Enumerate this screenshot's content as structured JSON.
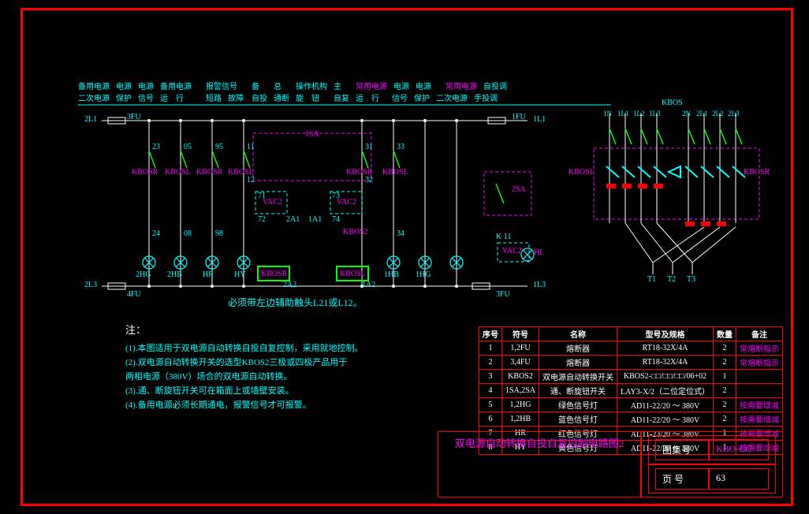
{
  "header": {
    "r1": [
      "备用电源",
      "电源",
      "电源",
      "备用电源",
      "报警信号",
      "备",
      "总",
      "操作机构",
      "主",
      "常用电源",
      "电源",
      "电源",
      "常用电源",
      "自投调"
    ],
    "r2": [
      "二次电源",
      "保护",
      "信号",
      "运",
      "行",
      "短路",
      "故障",
      "自投",
      "通断",
      "旋",
      "钮",
      "自复",
      "运",
      "行",
      "信号",
      "保护",
      "二次电源",
      "手投调"
    ]
  },
  "left_rails": {
    "top": "2L1",
    "bot": "2L3",
    "fuse_top": "3FU",
    "fuse_bot": "4FU"
  },
  "right_rails": {
    "top": "1L1",
    "bot": "1L3",
    "fuse_top": "1FU",
    "fuse_bot": "3FU"
  },
  "contacts": {
    "a": "23",
    "b": "05",
    "c": "95",
    "d": "11",
    "e": "31",
    "f": "33",
    "a2": "24",
    "b2": "08",
    "c2": "98",
    "d2": "12",
    "e2": "32",
    "f2": "34",
    "v71": "71",
    "v72": "72",
    "v73": "73",
    "v74": "74",
    "sa1": "1SA",
    "sa1b": "2A1",
    "sa1c": "1A1",
    "sa2": "2SA",
    "k2r": "KBOSR",
    "k2l": "KBOSL",
    "k1r": "KBOSR",
    "k1l": "KBOSL",
    "hb2": "2HB",
    "hg2": "2HG",
    "hr": "HR",
    "hy": "HY",
    "hb1": "1HB",
    "hg1": "1HG",
    "vac2": "VAC2",
    "vac2b": "VAC2",
    "kbos2": "KBOS2",
    "kb1": "KBOSR",
    "kb2": "KBOSL",
    "a2a": "2A2",
    "a1a": "1A2",
    "hl": "HL",
    "k11": "K 11"
  },
  "note_main": "必须带左边辅助触头L21或L12。",
  "notes_title": "注：",
  "notes": [
    "(1).本图适用于双电源自动转换自投自复控制，采用就地控制。",
    "(2).双电源自动转换开关的选型KBOS2三极或四极产品用于",
    "    两相电源（380V）场合的双电源自动转换。",
    "(3).通、断旋钮开关可在箱面上或墙壁安装。",
    "(4).备用电源必须长期通电，报警信号才可报警。"
  ],
  "power": {
    "title": "KBOS",
    "in": [
      "1N",
      "1L1",
      "1L2",
      "1L3",
      "2N",
      "2L1",
      "2L2",
      "2L3"
    ],
    "out": [
      "T1",
      "T2",
      "T3"
    ],
    "left": "KBOSL",
    "right": "KBOSR"
  },
  "table": {
    "head": [
      "序号",
      "符号",
      "名称",
      "型号及规格",
      "数量",
      "备注"
    ],
    "rows": [
      [
        "1",
        "1,2FU",
        "熔断器",
        "RT18-32X/4A",
        "2",
        "常熔断指示"
      ],
      [
        "2",
        "3,4FU",
        "熔断器",
        "RT18-32X/4A",
        "2",
        "常熔断指示"
      ],
      [
        "3",
        "KBOS2",
        "双电源自动转换开关",
        "KBOS2-□□/□□/□□/06+02",
        "1",
        ""
      ],
      [
        "4",
        "1SA,2SA",
        "通、断旋钮开关",
        "LAY3-X/2（二位定位式）",
        "2",
        ""
      ],
      [
        "5",
        "1,2HG",
        "绿色信号灯",
        "AD11-22/20 ～ 380V",
        "2",
        "按需要增减"
      ],
      [
        "6",
        "1,2HB",
        "蓝色信号灯",
        "AD11-22/20 ～ 380V",
        "2",
        "按需要增减"
      ],
      [
        "7",
        "HR",
        "红色信号灯",
        "AD11-23/20 ～ 380V",
        "1",
        "按需要增减"
      ],
      [
        "8",
        "HY",
        "黄色信号灯",
        "AD11-22/20 ～ 380V",
        "1",
        "按需要增减"
      ]
    ]
  },
  "title": "双电源自动转换自投自复控制电路图2",
  "tag": {
    "setlbl": "图集号",
    "set": "KBO-CC",
    "pglbl": "页 号",
    "pg": "63"
  }
}
